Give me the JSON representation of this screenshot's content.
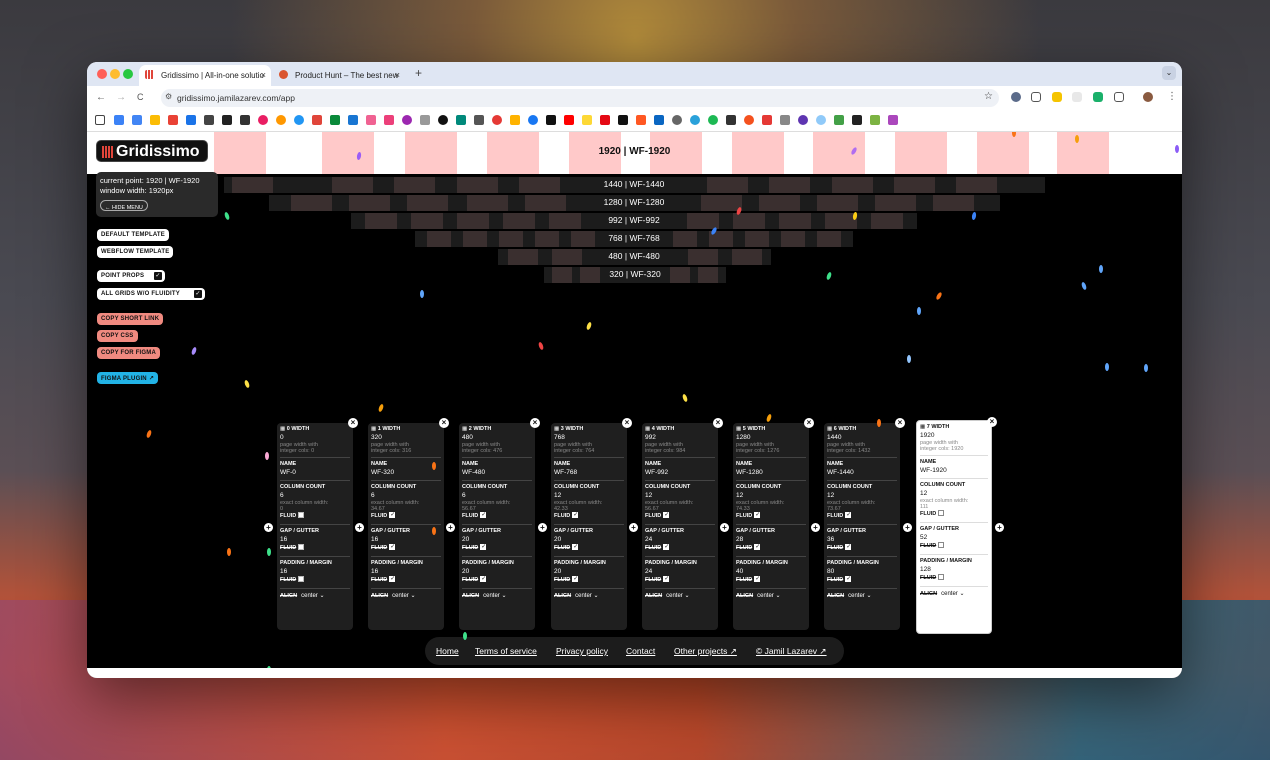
{
  "browser": {
    "tabs": [
      {
        "title": "Gridissimo | All-in-one solutio",
        "active": true
      },
      {
        "title": "Product Hunt – The best new",
        "active": false
      }
    ],
    "new_tab": "+",
    "tab_close": "×",
    "tab_menu": "⌄",
    "url": "gridissimo.jamilazarev.com/app",
    "nav": {
      "back": "←",
      "forward": "→",
      "reload": "C"
    },
    "star": "☆",
    "menu": "⋮"
  },
  "app": {
    "logo": "Gridissimo",
    "top_label": "1920 | WF-1920",
    "bands": [
      {
        "label": "1440 | WF-1440"
      },
      {
        "label": "1280 | WF-1280"
      },
      {
        "label": "992 | WF-992"
      },
      {
        "label": "768 | WF-768"
      },
      {
        "label": "480 | WF-480"
      },
      {
        "label": "320 | WF-320"
      }
    ],
    "info": {
      "line1": "current point: 1920 | WF-1920",
      "line2": "window width: 1920px",
      "hide_menu": "← HIDE MENU"
    },
    "buttons": {
      "default_template": "DEFAULT TEMPLATE",
      "webflow_template": "WEBFLOW TEMPLATE",
      "point_props": "POINT PROPS",
      "all_grids": "ALL GRIDS W/O FLUIDITY",
      "copy_short_link": "COPY SHORT LINK",
      "copy_css": "COPY CSS",
      "copy_for_figma": "COPY FOR FIGMA",
      "figma_plugin": "FIGMA PLUGIN ↗"
    },
    "labels": {
      "name": "NAME",
      "column_count": "COLUMN COUNT",
      "fluid": "FLUID",
      "gap": "GAP / GUTTER",
      "padding": "PADDING / MARGIN",
      "align": "ALIGN",
      "page_width_hint": "page width with",
      "exact_col": "exact column width:"
    },
    "cards": [
      {
        "title": "0 WIDTH",
        "width": "0",
        "int_cols": "integer cols: 0",
        "name": "WF-0",
        "cols": "6",
        "exact": "0",
        "col_fluid": false,
        "gap": "16",
        "gap_fluid": false,
        "pad": "16",
        "pad_fluid": false,
        "align": "center ⌄"
      },
      {
        "title": "1 WIDTH",
        "width": "320",
        "int_cols": "integer cols: 316",
        "name": "WF-320",
        "cols": "6",
        "exact": "34.67",
        "col_fluid": true,
        "gap": "16",
        "gap_fluid": true,
        "pad": "16",
        "pad_fluid": true,
        "align": "center ⌄"
      },
      {
        "title": "2 WIDTH",
        "width": "480",
        "int_cols": "integer cols: 476",
        "name": "WF-480",
        "cols": "6",
        "exact": "56.67",
        "col_fluid": true,
        "gap": "20",
        "gap_fluid": true,
        "pad": "20",
        "pad_fluid": true,
        "align": "center ⌄"
      },
      {
        "title": "3 WIDTH",
        "width": "768",
        "int_cols": "integer cols: 764",
        "name": "WF-768",
        "cols": "12",
        "exact": "42.33",
        "col_fluid": true,
        "gap": "20",
        "gap_fluid": true,
        "pad": "20",
        "pad_fluid": true,
        "align": "center ⌄"
      },
      {
        "title": "4 WIDTH",
        "width": "992",
        "int_cols": "integer cols: 984",
        "name": "WF-992",
        "cols": "12",
        "exact": "56.67",
        "col_fluid": true,
        "gap": "24",
        "gap_fluid": true,
        "pad": "24",
        "pad_fluid": true,
        "align": "center ⌄"
      },
      {
        "title": "5 WIDTH",
        "width": "1280",
        "int_cols": "integer cols: 1276",
        "name": "WF-1280",
        "cols": "12",
        "exact": "74.33",
        "col_fluid": true,
        "gap": "28",
        "gap_fluid": true,
        "pad": "40",
        "pad_fluid": true,
        "align": "center ⌄"
      },
      {
        "title": "6 WIDTH",
        "width": "1440",
        "int_cols": "integer cols: 1432",
        "name": "WF-1440",
        "cols": "12",
        "exact": "73.67",
        "col_fluid": true,
        "gap": "36",
        "gap_fluid": true,
        "pad": "80",
        "pad_fluid": true,
        "align": "center ⌄"
      },
      {
        "title": "7 WIDTH",
        "width": "1920",
        "int_cols": "integer cols: 1920",
        "name": "WF-1920",
        "cols": "12",
        "exact": "111",
        "col_fluid": false,
        "gap": "52",
        "gap_fluid": false,
        "pad": "128",
        "pad_fluid": false,
        "align": "center ⌄"
      }
    ],
    "footer": [
      "Home",
      "Terms of service",
      "Privacy policy",
      "Contact",
      "Other projects ↗",
      "© Jamil Lazarev ↗"
    ]
  },
  "colors": {
    "pink": "#ffc9c9",
    "accent_red": "#f08a80",
    "plugin_blue": "#22b3e6"
  }
}
